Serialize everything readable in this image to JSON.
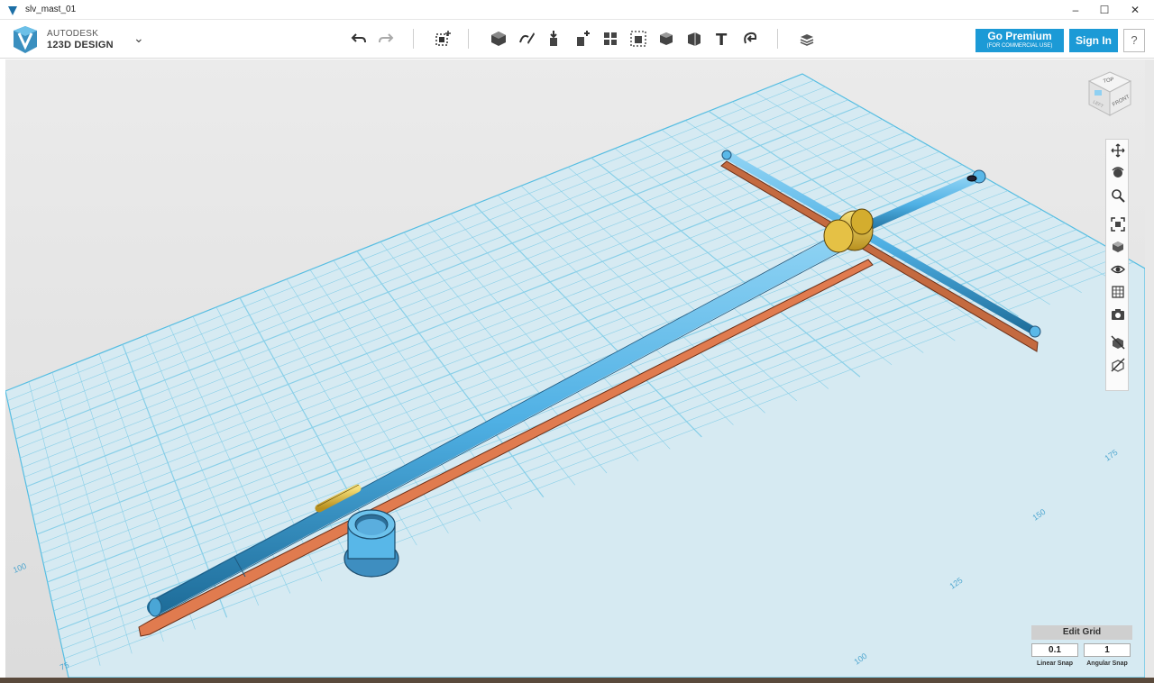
{
  "window": {
    "title": "slv_mast_01",
    "controls": [
      "–",
      "☐",
      "✕"
    ]
  },
  "app": {
    "logo_line1": "AUTODESK",
    "logo_line2": "123D DESIGN",
    "menu_chevron": "⌄"
  },
  "toolbar": {
    "items": [
      {
        "name": "undo-icon"
      },
      {
        "name": "redo-icon"
      },
      {
        "name": "transform-icon"
      },
      {
        "name": "primitives-icon"
      },
      {
        "name": "sketch-icon"
      },
      {
        "name": "construct-icon"
      },
      {
        "name": "modify-icon"
      },
      {
        "name": "pattern-icon"
      },
      {
        "name": "grouping-icon"
      },
      {
        "name": "combine-icon"
      },
      {
        "name": "measure-icon"
      },
      {
        "name": "text-icon"
      },
      {
        "name": "snap-icon"
      },
      {
        "name": "material-icon"
      }
    ],
    "text_tool_glyph": "T"
  },
  "account": {
    "premium_label": "Go Premium",
    "premium_sub": "(FOR COMMERCIAL USE)",
    "signin_label": "Sign In",
    "help_label": "?"
  },
  "viewcube": {
    "top": "TOP",
    "front": "FRONT",
    "left": "LEFT"
  },
  "navigation": {
    "items": [
      "pan-icon",
      "orbit-icon",
      "zoom-icon",
      "fit-icon",
      "view-icon",
      "visibility-icon",
      "materials-icon",
      "screenshot-icon",
      "hide-icon",
      "show-icon"
    ]
  },
  "grid": {
    "edit_label": "Edit Grid",
    "linear_snap_value": "0.1",
    "angular_snap_value": "1",
    "linear_snap_label": "Linear Snap",
    "angular_snap_label": "Angular Snap",
    "ruler_left": [
      "75",
      "100"
    ],
    "ruler_bottom": [
      "100",
      "125",
      "150",
      "175"
    ]
  },
  "colors": {
    "accent": "#1c9ad6",
    "grid_fill": "#d8ecf4",
    "grid_line": "#7fcbe6",
    "tube": "#58b7e8",
    "rail": "#e07b4f",
    "brass": "#e7c24a"
  }
}
